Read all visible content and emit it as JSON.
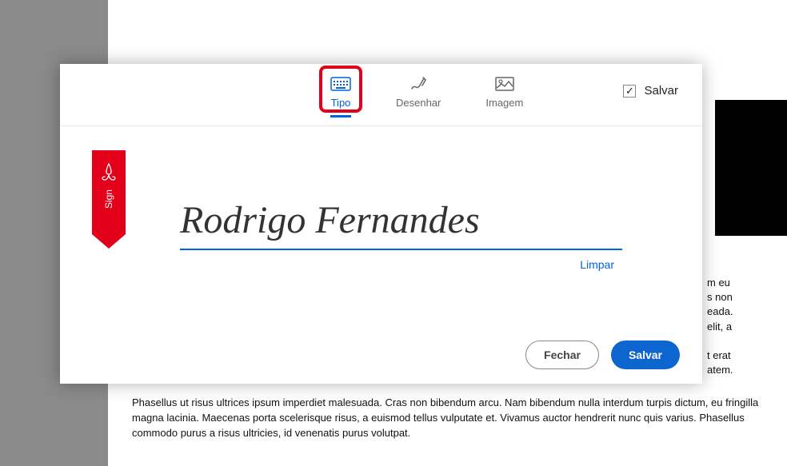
{
  "tabs": {
    "type": "Tipo",
    "draw": "Desenhar",
    "image": "Imagem"
  },
  "save_checkbox": "Salvar",
  "signature": {
    "text": "Rodrigo Fernandes",
    "clear_label": "Limpar"
  },
  "flag_text": "Sign",
  "buttons": {
    "close": "Fechar",
    "save": "Salvar"
  },
  "background_text": {
    "line_right_1": "m eu",
    "line_right_2": "s non",
    "line_right_3": "eada.",
    "line_right_4": "elit, a",
    "line_right_5": "t erat",
    "line_right_6": "atem.",
    "para2": "Phasellus ut risus ultrices ipsum imperdiet malesuada. Cras non bibendum arcu. Nam bibendum nulla interdum turpis dictum, eu fringilla magna lacinia. Maecenas porta scelerisque risus, a euismod tellus vulputate et. Vivamus auctor hendrerit nunc quis varius. Phasellus commodo purus a risus ultricies, id venenatis purus volutpat."
  }
}
